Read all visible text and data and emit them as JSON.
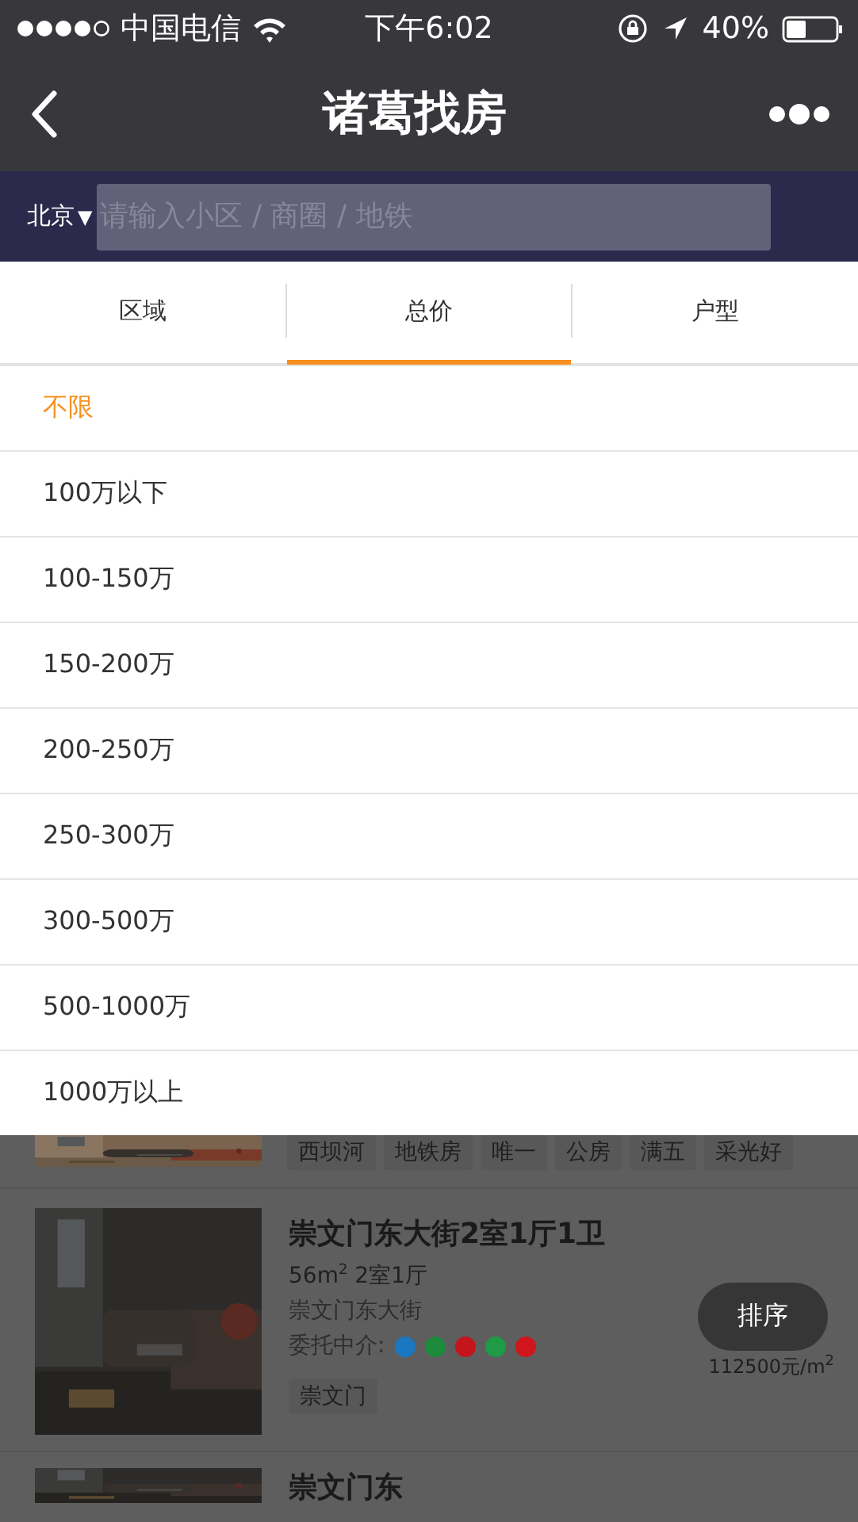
{
  "status_bar": {
    "carrier": "中国电信",
    "time": "下午6:02",
    "battery": "40%"
  },
  "nav": {
    "title": "诸葛找房"
  },
  "search": {
    "city": "北京",
    "city_caret": "▼",
    "placeholder": "请输入小区 / 商圈 / 地铁"
  },
  "filter_tabs": [
    {
      "label": "区域",
      "selected": false
    },
    {
      "label": "总价",
      "selected": true
    },
    {
      "label": "户型",
      "selected": false
    }
  ],
  "options": [
    {
      "label": "不限",
      "selected": true
    },
    {
      "label": "100万以下",
      "selected": false
    },
    {
      "label": "100-150万",
      "selected": false
    },
    {
      "label": "150-200万",
      "selected": false
    },
    {
      "label": "200-250万",
      "selected": false
    },
    {
      "label": "250-300万",
      "selected": false
    },
    {
      "label": "300-500万",
      "selected": false
    },
    {
      "label": "500-1000万",
      "selected": false
    },
    {
      "label": "1000万以上",
      "selected": false
    }
  ],
  "listings": [
    {
      "tags": [
        "西坝河",
        "地铁房",
        "唯一",
        "公房",
        "满五",
        "采光好"
      ]
    },
    {
      "title": "崇文门东大街2室1厅1卫",
      "area": "56m$^{2}$ 2室1厅",
      "address": "崇文门东大街",
      "agency_label": "委托中介:",
      "agencies": [
        {
          "color": "#1a78c2"
        },
        {
          "color": "#1d8a3c"
        },
        {
          "color": "#c4151c"
        },
        {
          "color": "#1f9a45"
        },
        {
          "color": "#d0161c"
        }
      ],
      "unit_price": "112500元/m$^{2}$",
      "tags": [
        "崇文门"
      ]
    },
    {
      "title": "崇文门东"
    }
  ],
  "sort_button": "排序"
}
